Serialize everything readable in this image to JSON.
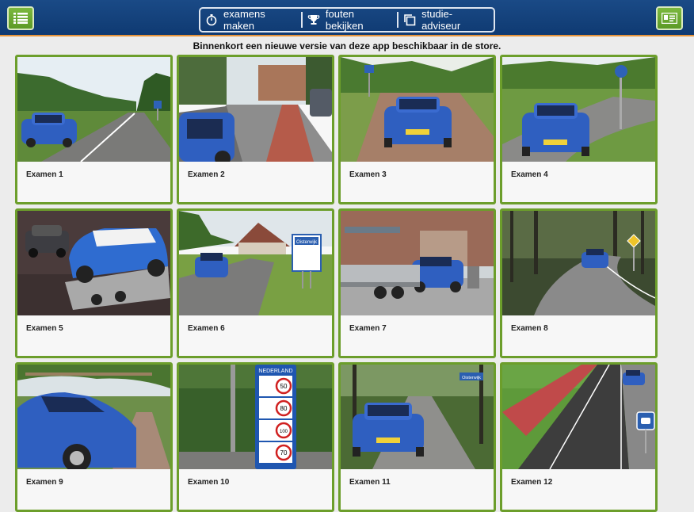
{
  "header": {
    "menu_icon": "list-icon",
    "profile_icon": "id-card-icon",
    "nav": [
      {
        "label": "examens maken",
        "icon": "stopwatch-icon"
      },
      {
        "label": "fouten bekijken",
        "icon": "trophy-icon"
      },
      {
        "label": "studie-adviseur",
        "icon": "copy-icon"
      }
    ]
  },
  "notice": "Binnenkort een nieuwe versie van deze app beschikbaar in de store.",
  "exams": [
    {
      "label": "Examen 1"
    },
    {
      "label": "Examen 2"
    },
    {
      "label": "Examen 3"
    },
    {
      "label": "Examen 4"
    },
    {
      "label": "Examen 5"
    },
    {
      "label": "Examen 6"
    },
    {
      "label": "Examen 7"
    },
    {
      "label": "Examen 8"
    },
    {
      "label": "Examen 9"
    },
    {
      "label": "Examen 10"
    },
    {
      "label": "Examen 11"
    },
    {
      "label": "Examen 12"
    }
  ],
  "photo_text": {
    "sign_place": "Oisterwijk",
    "sign_country": "NEDERLAND",
    "speed_50": "50",
    "speed_80": "80",
    "speed_100": "100",
    "speed_70": "70"
  },
  "colors": {
    "topbar": "#12407a",
    "accent_green": "#6c9e2b",
    "tile_bg": "#f7f7f7",
    "car_blue": "#2f5fc0"
  }
}
